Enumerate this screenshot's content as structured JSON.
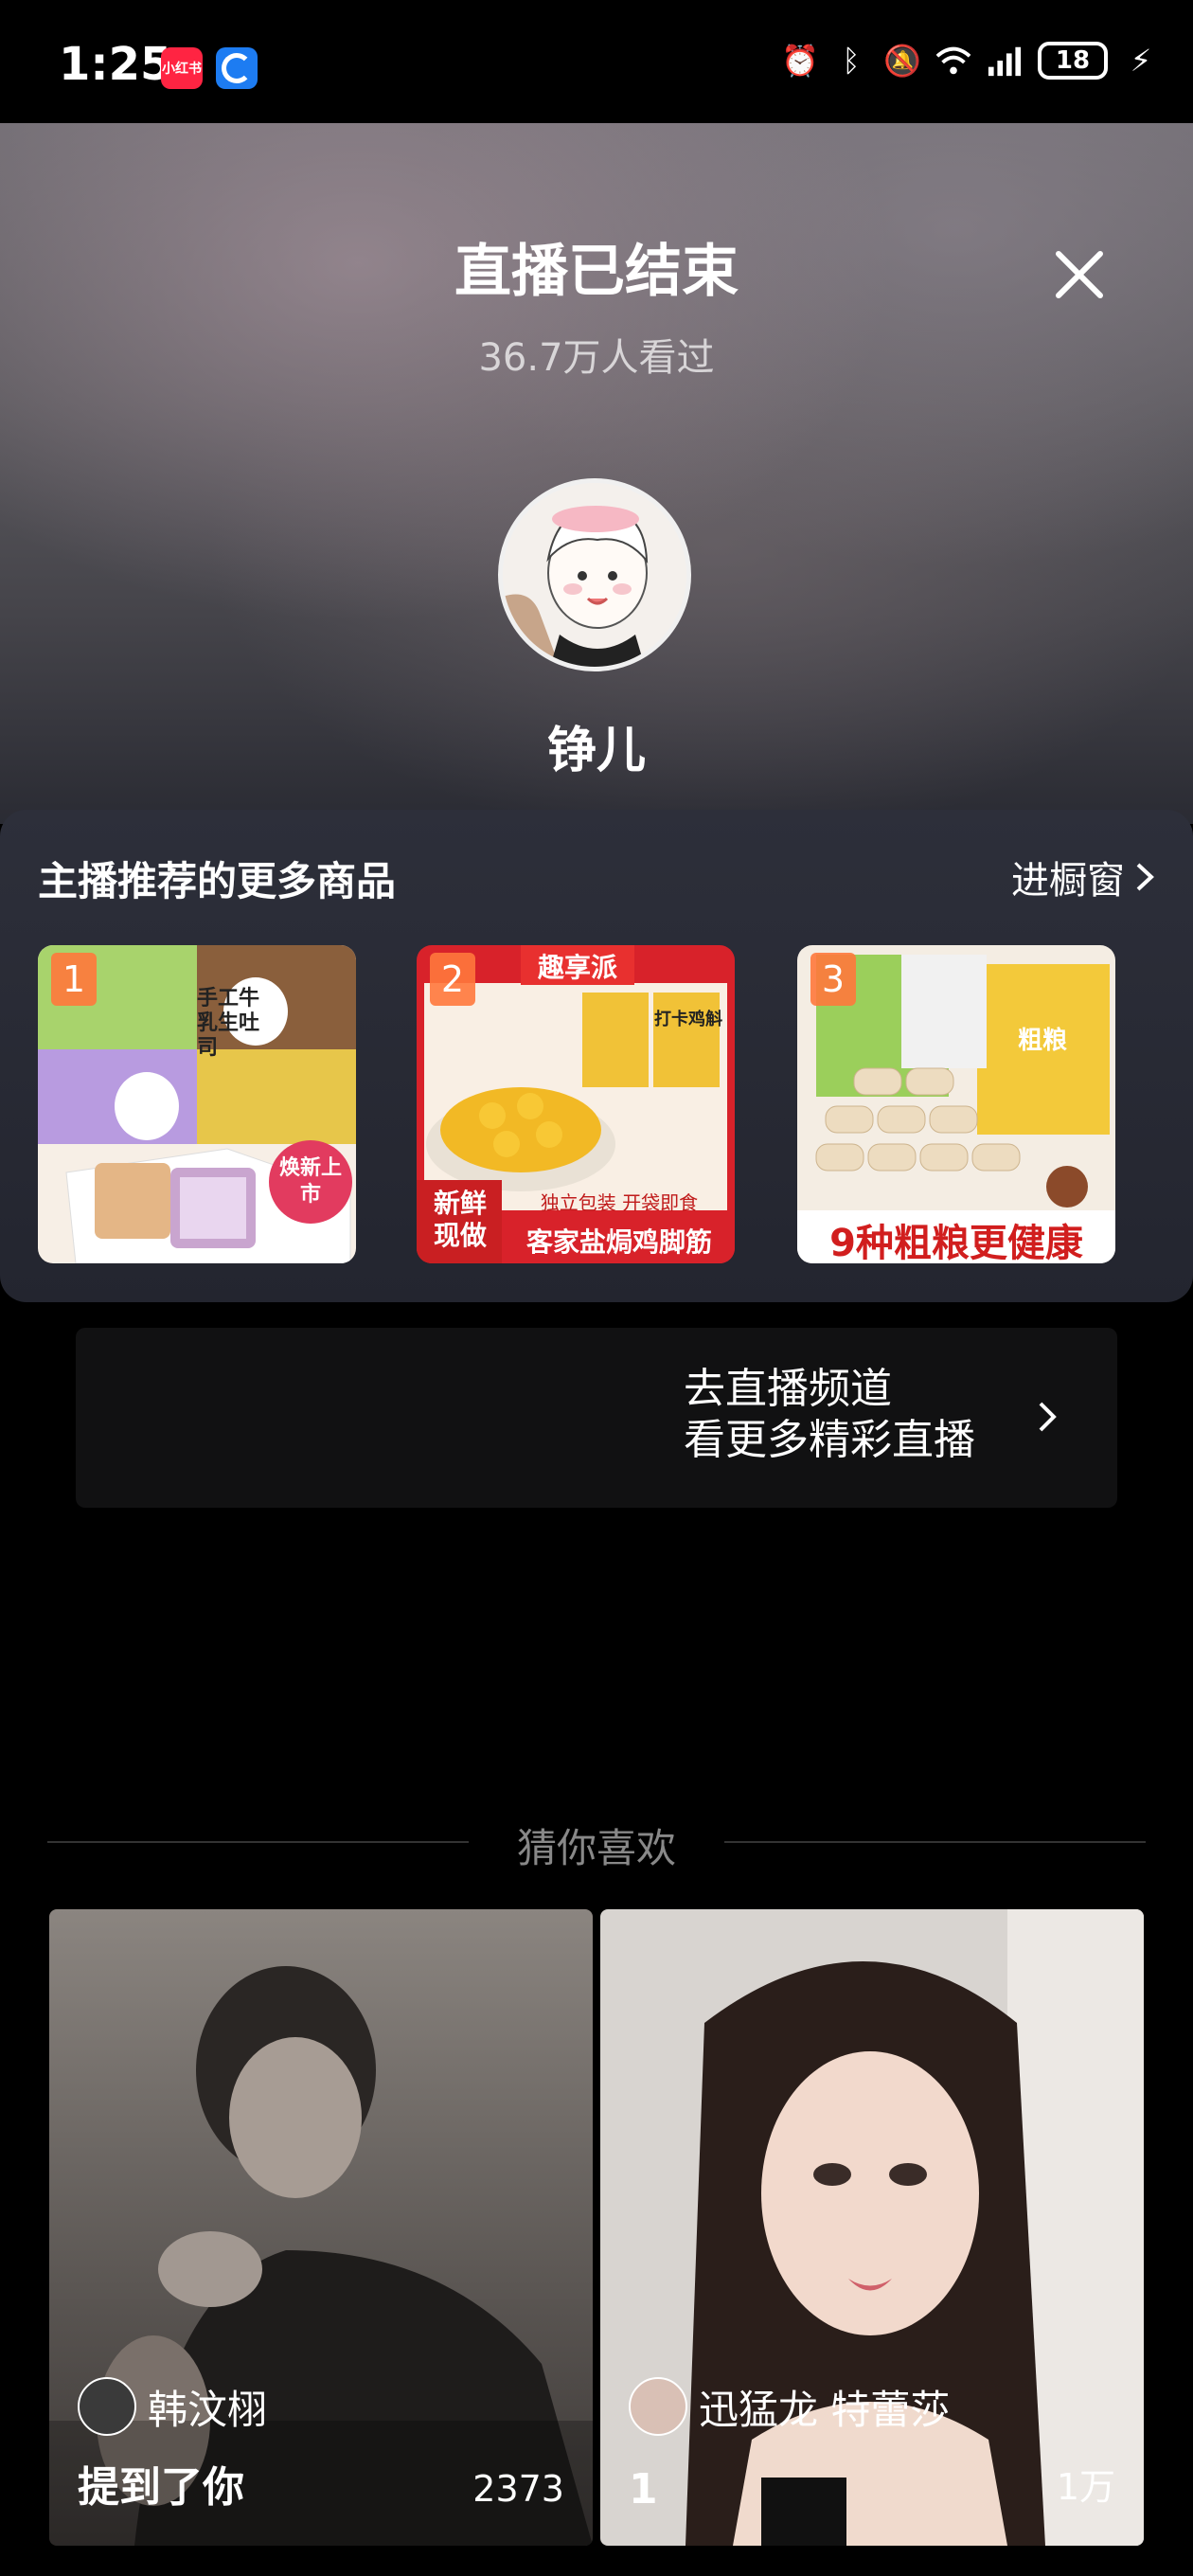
{
  "status_bar": {
    "time": "1:25",
    "app1_label": "小红书",
    "battery": "18"
  },
  "header": {
    "title": "直播已结束",
    "viewers": "36.7万人看过",
    "host_name": "铮儿"
  },
  "products": {
    "section_title": "主播推荐的更多商品",
    "link_label": "进橱窗",
    "items": [
      {
        "rank": "1",
        "badge": "焕新上市",
        "label": "手工牛乳生吐司"
      },
      {
        "rank": "2",
        "brand": "趣享派",
        "badge": "新鲜现做",
        "label": "客家盐焗鸡脚筋",
        "sub": "独立包装 开袋即食",
        "pack": "打卡鸡斛"
      },
      {
        "rank": "3",
        "label": "9种粗粮更健康",
        "pack": "粗粮"
      }
    ]
  },
  "channel": {
    "line1": "去直播频道",
    "line2": "看更多精彩直播"
  },
  "recommendations": {
    "title": "猜你喜欢",
    "cards": [
      {
        "user": "韩汶栩",
        "title": "提到了你",
        "count": "2373"
      },
      {
        "user": "迅猛龙 特蕾莎",
        "title": "1",
        "count": "1万"
      }
    ]
  },
  "colors": {
    "background": "#000000",
    "panel": "#2a2c36",
    "accent_red": "#ff2442"
  }
}
